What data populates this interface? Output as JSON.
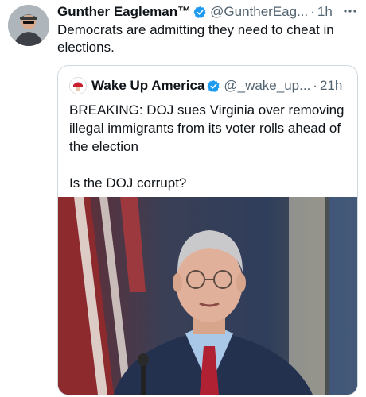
{
  "tweet": {
    "author_name": "Gunther Eagleman™",
    "handle": "@GuntherEag...",
    "separator": "·",
    "time": "1h",
    "text": "Democrats are admitting they need to cheat in elections."
  },
  "quote": {
    "author_name": "Wake Up America",
    "handle": "@_wake_up...",
    "separator": "·",
    "time": "21h",
    "text": "BREAKING: DOJ sues Virginia over removing illegal immigrants from its voter rolls ahead of the election\n\nIs the DOJ corrupt?"
  },
  "icons": {
    "verified": "verified-badge-icon",
    "more": "more-horizontal-icon"
  },
  "colors": {
    "verified_blue": "#1d9bf0",
    "secondary_text": "#536471",
    "border": "#cfd9de"
  }
}
